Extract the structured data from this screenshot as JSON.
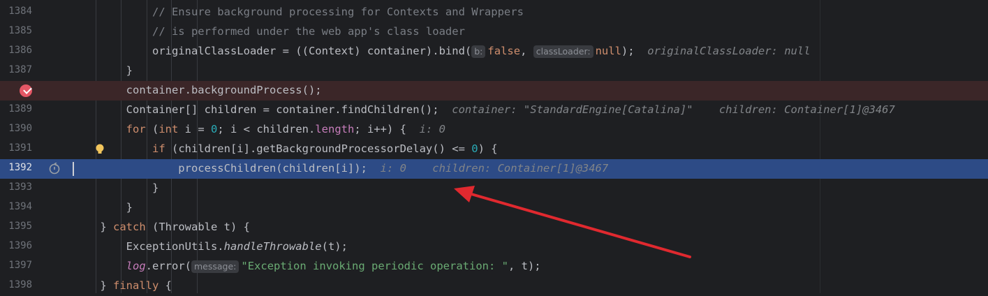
{
  "lines": [
    {
      "n": "1384",
      "parts": [
        {
          "t": "            "
        },
        {
          "t": "// Ensure background processing for Contexts and Wrappers",
          "c": "cmt"
        }
      ]
    },
    {
      "n": "1385",
      "parts": [
        {
          "t": "            "
        },
        {
          "t": "// is performed under the web app's class loader",
          "c": "cmt"
        }
      ]
    },
    {
      "n": "1386",
      "parts": [
        {
          "t": "            originalClassLoader = ((Context) container).bind("
        },
        {
          "t": "b:",
          "c": "hint"
        },
        {
          "t": "false",
          "c": "kw"
        },
        {
          "t": ", "
        },
        {
          "t": "classLoader:",
          "c": "hint"
        },
        {
          "t": "null",
          "c": "kw"
        },
        {
          "t": ");  "
        },
        {
          "t": "originalClassLoader: null",
          "c": "inl"
        }
      ]
    },
    {
      "n": "1387",
      "parts": [
        {
          "t": "        }"
        }
      ]
    },
    {
      "n": "",
      "parts": [
        {
          "t": "        container.backgroundProcess();"
        }
      ]
    },
    {
      "n": "1389",
      "parts": [
        {
          "t": "        Container[] children = container.findChildren();  "
        },
        {
          "t": "container: \"StandardEngine[Catalina]\"    children: Container[1]@3467",
          "c": "inl"
        }
      ]
    },
    {
      "n": "1390",
      "parts": [
        {
          "t": "        "
        },
        {
          "t": "for",
          "c": "kw"
        },
        {
          "t": " ("
        },
        {
          "t": "int",
          "c": "kw"
        },
        {
          "t": " i = "
        },
        {
          "t": "0",
          "c": "num"
        },
        {
          "t": "; i < children."
        },
        {
          "t": "length",
          "c": "fld"
        },
        {
          "t": "; i++) {  "
        },
        {
          "t": "i: 0",
          "c": "inl"
        }
      ]
    },
    {
      "n": "1391",
      "parts": [
        {
          "t": "            "
        },
        {
          "t": "if",
          "c": "kw"
        },
        {
          "t": " (children[i].getBackgroundProcessorDelay() <= "
        },
        {
          "t": "0",
          "c": "num"
        },
        {
          "t": ") {"
        }
      ]
    },
    {
      "n": "1392",
      "parts": [
        {
          "t": "                processChildren(children[i]);  "
        },
        {
          "t": "i: 0    children: Container[1]@3467",
          "c": "inl"
        }
      ]
    },
    {
      "n": "1393",
      "parts": [
        {
          "t": "            }"
        }
      ]
    },
    {
      "n": "1394",
      "parts": [
        {
          "t": "        }"
        }
      ]
    },
    {
      "n": "1395",
      "parts": [
        {
          "t": "    } "
        },
        {
          "t": "catch",
          "c": "kw"
        },
        {
          "t": " (Throwable t) {"
        }
      ]
    },
    {
      "n": "1396",
      "parts": [
        {
          "t": "        ExceptionUtils."
        },
        {
          "t": "handleThrowable",
          "c": "it"
        },
        {
          "t": "(t);"
        }
      ]
    },
    {
      "n": "1397",
      "parts": [
        {
          "t": "        "
        },
        {
          "t": "log",
          "c": "fld it"
        },
        {
          "t": ".error("
        },
        {
          "t": "message:",
          "c": "hint"
        },
        {
          "t": "\"Exception invoking periodic operation: \"",
          "c": "str"
        },
        {
          "t": ", t);"
        }
      ]
    },
    {
      "n": "1398",
      "parts": [
        {
          "t": "    } "
        },
        {
          "t": "finally",
          "c": "kw"
        },
        {
          "t": " {"
        }
      ]
    }
  ],
  "icons": {
    "breakpoint": "breakpoint-icon",
    "bulb": "lightbulb-icon",
    "reset_frame": "reset-frame-icon"
  },
  "colors": {
    "background": "#1e1f22",
    "breakpoint_line": "#3b2628",
    "execution_line": "#2d4b86",
    "arrow": "#e0292f"
  }
}
